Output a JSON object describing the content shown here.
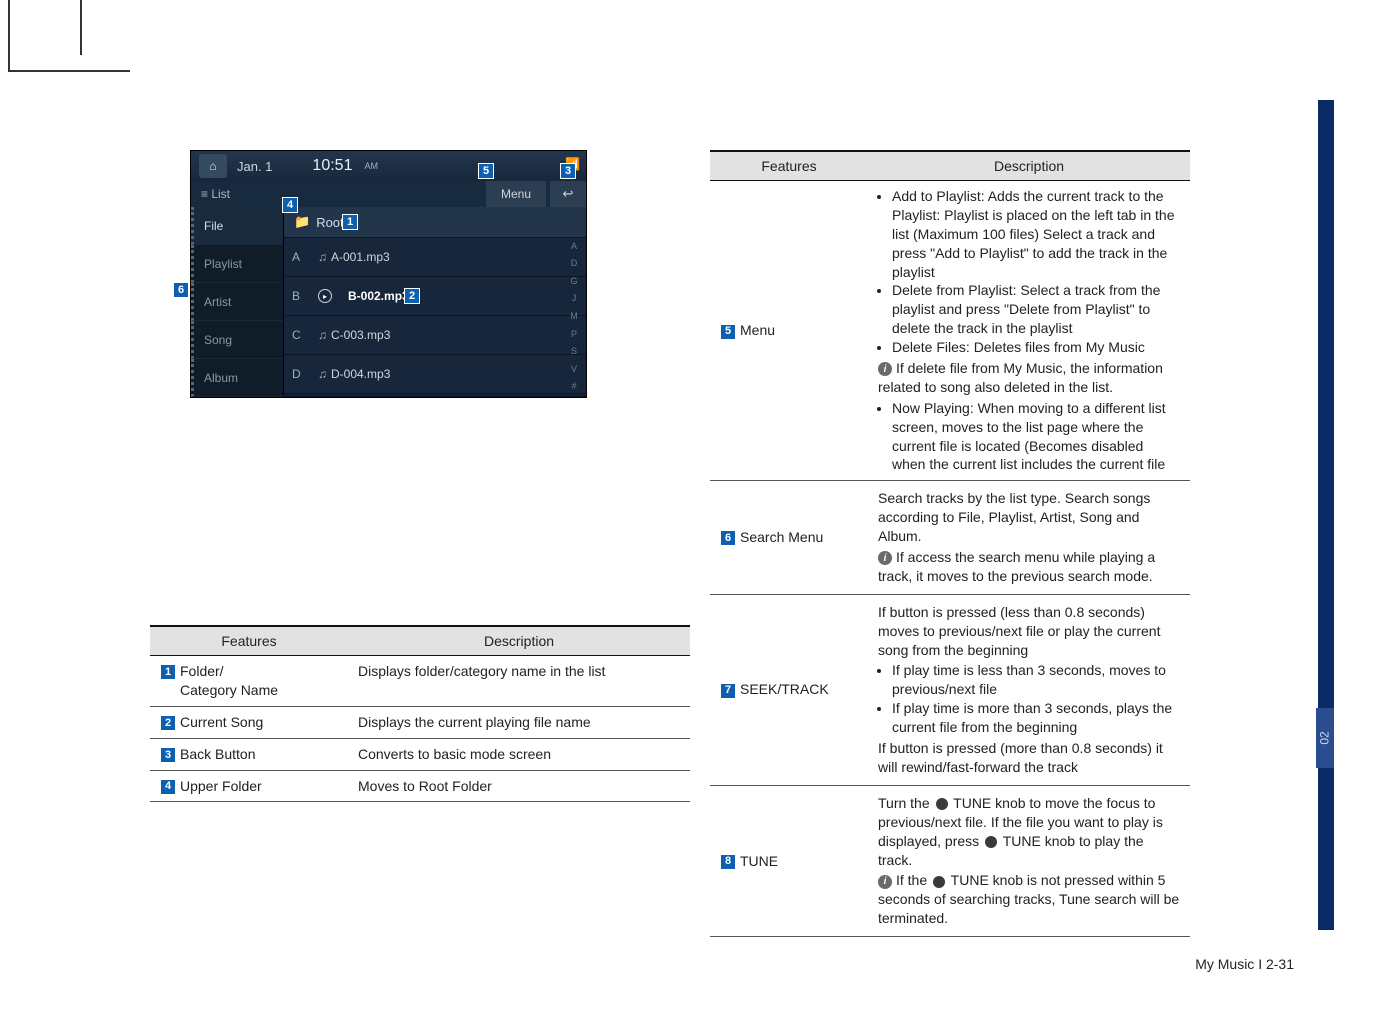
{
  "page": {
    "section_tab": "02",
    "footer": "My Music I 2-31"
  },
  "screenshot": {
    "date_label": "Jan.  1",
    "clock": "10:51",
    "clock_suffix": "AM",
    "list_label": "≡ List",
    "menu_label": "Menu",
    "root_label": "Root",
    "side_items": [
      "File",
      "Playlist",
      "Artist",
      "Song",
      "Album"
    ],
    "rows": [
      {
        "letter": "A",
        "track": "A-001.mp3",
        "playing": false
      },
      {
        "letter": "B",
        "track": "B-002.mp3",
        "playing": true
      },
      {
        "letter": "C",
        "track": "C-003.mp3",
        "playing": false
      },
      {
        "letter": "D",
        "track": "D-004.mp3",
        "playing": false
      }
    ],
    "index_letters": [
      "A",
      "D",
      "G",
      "J",
      "M",
      "P",
      "S",
      "V",
      "#"
    ]
  },
  "callouts": {
    "c1": "1",
    "c2": "2",
    "c3": "3",
    "c4": "4",
    "c5": "5",
    "c6": "6",
    "c7": "7",
    "c8": "8"
  },
  "table1": {
    "head_features": "Features",
    "head_description": "Description",
    "rows": [
      {
        "num": "1",
        "feature": "Folder/\nCategory Name",
        "desc": "Displays folder/category name in the list"
      },
      {
        "num": "2",
        "feature": "Current Song",
        "desc": "Displays the current playing file name"
      },
      {
        "num": "3",
        "feature": "Back Button",
        "desc": "Converts to basic mode screen"
      },
      {
        "num": "4",
        "feature": "Upper Folder",
        "desc": "Moves to Root Folder"
      }
    ]
  },
  "table2": {
    "head_features": "Features",
    "head_description": "Description",
    "row_menu": {
      "num": "5",
      "feature": "Menu",
      "bul1": "Add to Playlist: Adds the current track to the Playlist: Playlist is placed on the left tab in the list (Maximum 100 files) Select a track and press \"Add to Playlist\" to add the track in the playlist",
      "bul2": "Delete from Playlist: Select a track from the playlist and press \"Delete from Playlist\" to delete the track in the playlist",
      "bul3": "Delete Files: Deletes files from My Music",
      "info1": "If delete file from My Music, the information related to song also deleted in the list.",
      "bul4": "Now Playing: When moving to a different list screen, moves to the list page where the current file is located (Becomes disabled when the current list includes the current file"
    },
    "row_search": {
      "num": "6",
      "feature": "Search Menu",
      "p1": "Search tracks by the list type. Search songs according to File, Playlist, Artist, Song and Album.",
      "info1": "If access the search menu while playing a track, it moves to the previous search mode."
    },
    "row_seek": {
      "num": "7",
      "feature": "SEEK/TRACK",
      "p1": "If button is pressed (less than 0.8 seconds) moves to previous/next file or play the current song from the beginning",
      "bul1": "If play time is less than 3 seconds, moves to previous/next file",
      "bul2": "If play time is more than 3 seconds, plays the current file from the beginning",
      "p2": "If button is pressed (more than 0.8 seconds) it will rewind/fast-forward the track"
    },
    "row_tune": {
      "num": "8",
      "feature": "TUNE",
      "p1a": "Turn the ",
      "p1b": " TUNE knob to move the focus to previous/next file. If the file you want to play is displayed, press ",
      "p1c": " TUNE knob to play the track.",
      "info1a": "If the ",
      "info1b": " TUNE knob is not pressed within 5 seconds of searching tracks, Tune search will be terminated."
    }
  }
}
